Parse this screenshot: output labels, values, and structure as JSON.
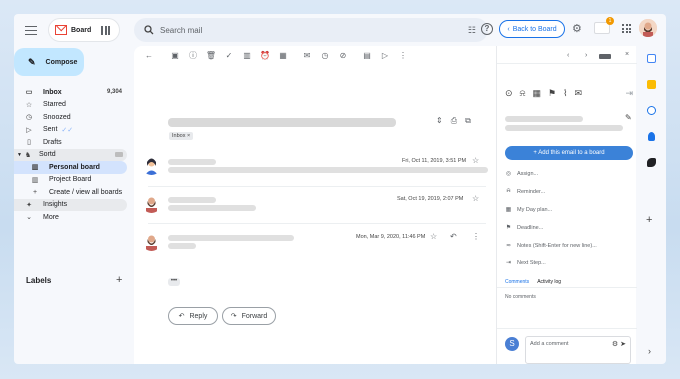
{
  "header": {
    "board_label": "Board",
    "search_placeholder": "Search mail",
    "back_to_board": "Back to Board",
    "help": "?",
    "notification_count": "1"
  },
  "sidebar": {
    "compose": "Compose",
    "items": [
      {
        "label": "Inbox",
        "count": "9,304",
        "icon": "inbox-icon"
      },
      {
        "label": "Starred",
        "icon": "star-icon"
      },
      {
        "label": "Snoozed",
        "icon": "clock-icon"
      },
      {
        "label": "Sent",
        "icon": "send-icon"
      },
      {
        "label": "Drafts",
        "icon": "draft-icon"
      },
      {
        "label": "Sortd",
        "icon": "sortd-icon"
      },
      {
        "label": "Personal board",
        "icon": "board-icon"
      },
      {
        "label": "Project Board",
        "icon": "board-icon"
      },
      {
        "label": "Create / view all boards",
        "icon": "plus-icon"
      },
      {
        "label": "Insights",
        "icon": "sparkle-icon"
      },
      {
        "label": "More",
        "icon": "chevron-down-icon"
      }
    ],
    "labels_heading": "Labels"
  },
  "thread": {
    "tag": "Inbox",
    "messages": [
      {
        "date": "Fri, Oct 11, 2019, 3:51 PM"
      },
      {
        "date": "Sat, Oct 19, 2019, 2:07 PM"
      },
      {
        "date": "Mon, Mar 9, 2020, 11:46 PM"
      }
    ],
    "more_dots": "•••",
    "reply": "Reply",
    "forward": "Forward"
  },
  "panel": {
    "add_to_board": "+ Add this email to a board",
    "rows": [
      {
        "label": "Assign...",
        "icon": "assign-icon"
      },
      {
        "label": "Reminder...",
        "icon": "bell-icon"
      },
      {
        "label": "My Day plan...",
        "icon": "calendar-icon"
      },
      {
        "label": "Deadline...",
        "icon": "flag-icon"
      },
      {
        "label": "Notes (Shift-Enter for new line)...",
        "icon": "notes-icon"
      },
      {
        "label": "Next Step...",
        "icon": "next-step-icon"
      }
    ],
    "tab_comments": "Comments",
    "tab_activity": "Activity log",
    "no_comments": "No comments",
    "comment_avatar": "S",
    "comment_placeholder": "Add a comment"
  }
}
